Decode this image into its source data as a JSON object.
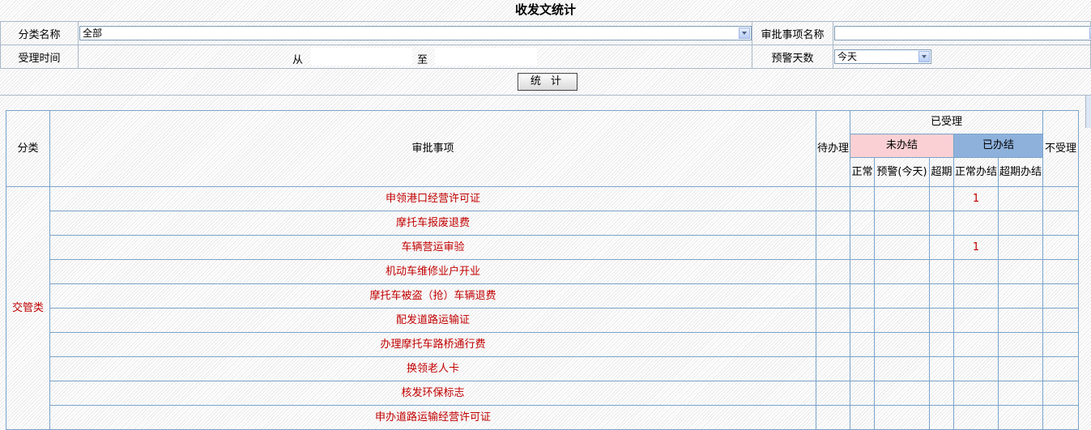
{
  "page": {
    "title": "收发文统计"
  },
  "form": {
    "category_label": "分类名称",
    "category_value": "全部",
    "item_label": "审批事项名称",
    "item_value": "",
    "time_label": "受理时间",
    "from_label": "从",
    "to_label": "至",
    "warning_label": "预警天数",
    "warning_value": "今天",
    "stat_button": "统 计"
  },
  "grid": {
    "headers": {
      "category": "分类",
      "item": "审批事项",
      "pending": "待办理",
      "accepted": "已受理",
      "unfinished": "未办结",
      "finished": "已办结",
      "rejected": "不受理",
      "normal": "正常",
      "warning": "预警(今天)",
      "overdue": "超期",
      "finished_normal": "正常办结",
      "finished_overdue": "超期办结"
    },
    "group": "交管类",
    "rows": [
      {
        "name": "申领港口经营许可证",
        "finished_normal": "1"
      },
      {
        "name": "摩托车报废退费",
        "finished_normal": ""
      },
      {
        "name": "车辆营运审验",
        "finished_normal": "1"
      },
      {
        "name": "机动车维修业户开业",
        "finished_normal": ""
      },
      {
        "name": "摩托车被盗（抢）车辆退费",
        "finished_normal": ""
      },
      {
        "name": "配发道路运输证",
        "finished_normal": ""
      },
      {
        "name": "办理摩托车路桥通行费",
        "finished_normal": ""
      },
      {
        "name": "换领老人卡",
        "finished_normal": ""
      },
      {
        "name": "核发环保标志",
        "finished_normal": ""
      },
      {
        "name": "申办道路运输经营许可证",
        "finished_normal": ""
      }
    ]
  }
}
